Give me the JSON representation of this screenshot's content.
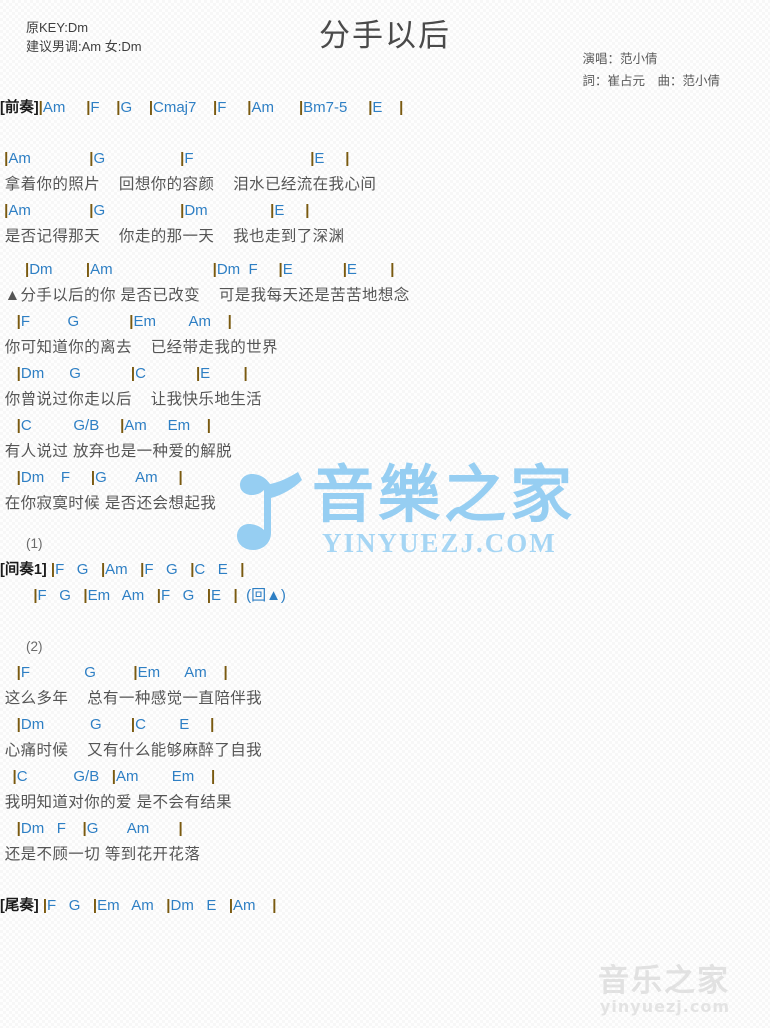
{
  "header": {
    "key_line_1": "原KEY:Dm",
    "key_line_2": "建议男调:Am 女:Dm",
    "title": "分手以后",
    "credit_singer": "演唱：范小倩",
    "credit_words_music": "詞：崔占元　曲：范小倩"
  },
  "sections": [
    {
      "name": "intro",
      "tag": "[前奏]",
      "chords": "|Am     |F    |G    |Cmaj7    |F     |Am      |Bm7-5     |E    |"
    },
    {
      "name": "verse-1",
      "lines": [
        {
          "type": "chord",
          "text": " |Am              |G                  |F                            |E     |"
        },
        {
          "type": "lyric",
          "text": " 拿着你的照片    回想你的容颜    泪水已经流在我心间"
        },
        {
          "type": "chord",
          "text": " |Am              |G                  |Dm               |E     |"
        },
        {
          "type": "lyric",
          "text": " 是否记得那天    你走的那一天    我也走到了深渊"
        }
      ]
    },
    {
      "name": "chorus",
      "lines": [
        {
          "type": "chord",
          "text": "      |Dm        |Am                        |Dm  F     |E            |E        |"
        },
        {
          "type": "lyric",
          "text": " ▲分手以后的你 是否已改变    可是我每天还是苦苦地想念"
        },
        {
          "type": "chord",
          "text": "    |F         G            |Em        Am    |"
        },
        {
          "type": "lyric",
          "text": " 你可知道你的离去    已经带走我的世界"
        },
        {
          "type": "chord",
          "text": "    |Dm      G            |C            |E        |"
        },
        {
          "type": "lyric",
          "text": " 你曾说过你走以后    让我快乐地生活"
        },
        {
          "type": "chord",
          "text": "    |C          G/B     |Am     Em    |"
        },
        {
          "type": "lyric",
          "text": " 有人说过 放弃也是一种爱的解脱"
        },
        {
          "type": "chord",
          "text": "    |Dm    F     |G       Am     |"
        },
        {
          "type": "lyric",
          "text": " 在你寂寞时候 是否还会想起我"
        }
      ]
    },
    {
      "name": "interlude",
      "number": "(1)",
      "tag": "[间奏1]",
      "line_1": " |F   G   |Am   |F   G   |C   E   |",
      "line_2": "        |F   G   |Em   Am   |F   G   |E   |  (回▲)",
      "repeat_mark": "(回▲)"
    },
    {
      "name": "verse-2",
      "number": "(2)",
      "lines": [
        {
          "type": "chord",
          "text": "    |F             G         |Em      Am    |"
        },
        {
          "type": "lyric",
          "text": " 这么多年    总有一种感觉一直陪伴我"
        },
        {
          "type": "chord",
          "text": "    |Dm           G       |C        E     |"
        },
        {
          "type": "lyric",
          "text": " 心痛时候    又有什么能够麻醉了自我"
        },
        {
          "type": "chord",
          "text": "   |C           G/B   |Am        Em    |"
        },
        {
          "type": "lyric",
          "text": " 我明知道对你的爱 是不会有结果"
        },
        {
          "type": "chord",
          "text": "    |Dm   F    |G       Am       |"
        },
        {
          "type": "lyric",
          "text": " 还是不顾一切 等到花开花落"
        }
      ]
    },
    {
      "name": "outro",
      "tag": "[尾奏]",
      "chords": " |F   G   |Em   Am   |Dm   E   |Am    |"
    }
  ],
  "watermarks": {
    "main_cn": "音樂之家",
    "main_en": "YINYUEZJ.COM",
    "bottom_cn": "音乐之家",
    "bottom_en": "yinyuezj.com"
  },
  "colors": {
    "chord": "#2e7fc4",
    "lyric": "#555555",
    "bar": "#7a5a10",
    "title": "#4a4a4a",
    "watermark_blue": "#8ecbf2",
    "background": "#f7f7f7"
  }
}
